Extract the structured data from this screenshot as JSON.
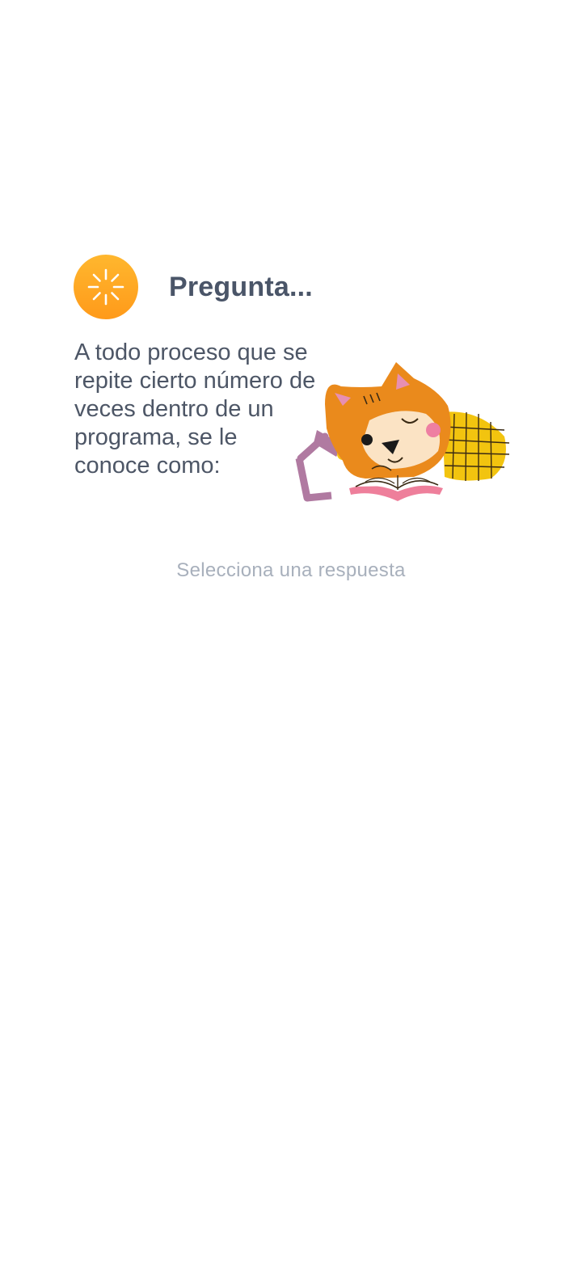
{
  "header": {
    "icon": "sparkle-icon",
    "title": "Pregunta..."
  },
  "question": {
    "text": "A todo proceso que se repite cierto número de veces dentro de un programa, se le conoce como:"
  },
  "illustration": {
    "name": "fox-reading-book-illustration"
  },
  "answers": {
    "hint": "Selecciona una respuesta"
  },
  "colors": {
    "accent": "#ff9f1c",
    "title": "#4a5568",
    "body_text": "#4d5666",
    "hint_text": "#a8b0bc"
  }
}
